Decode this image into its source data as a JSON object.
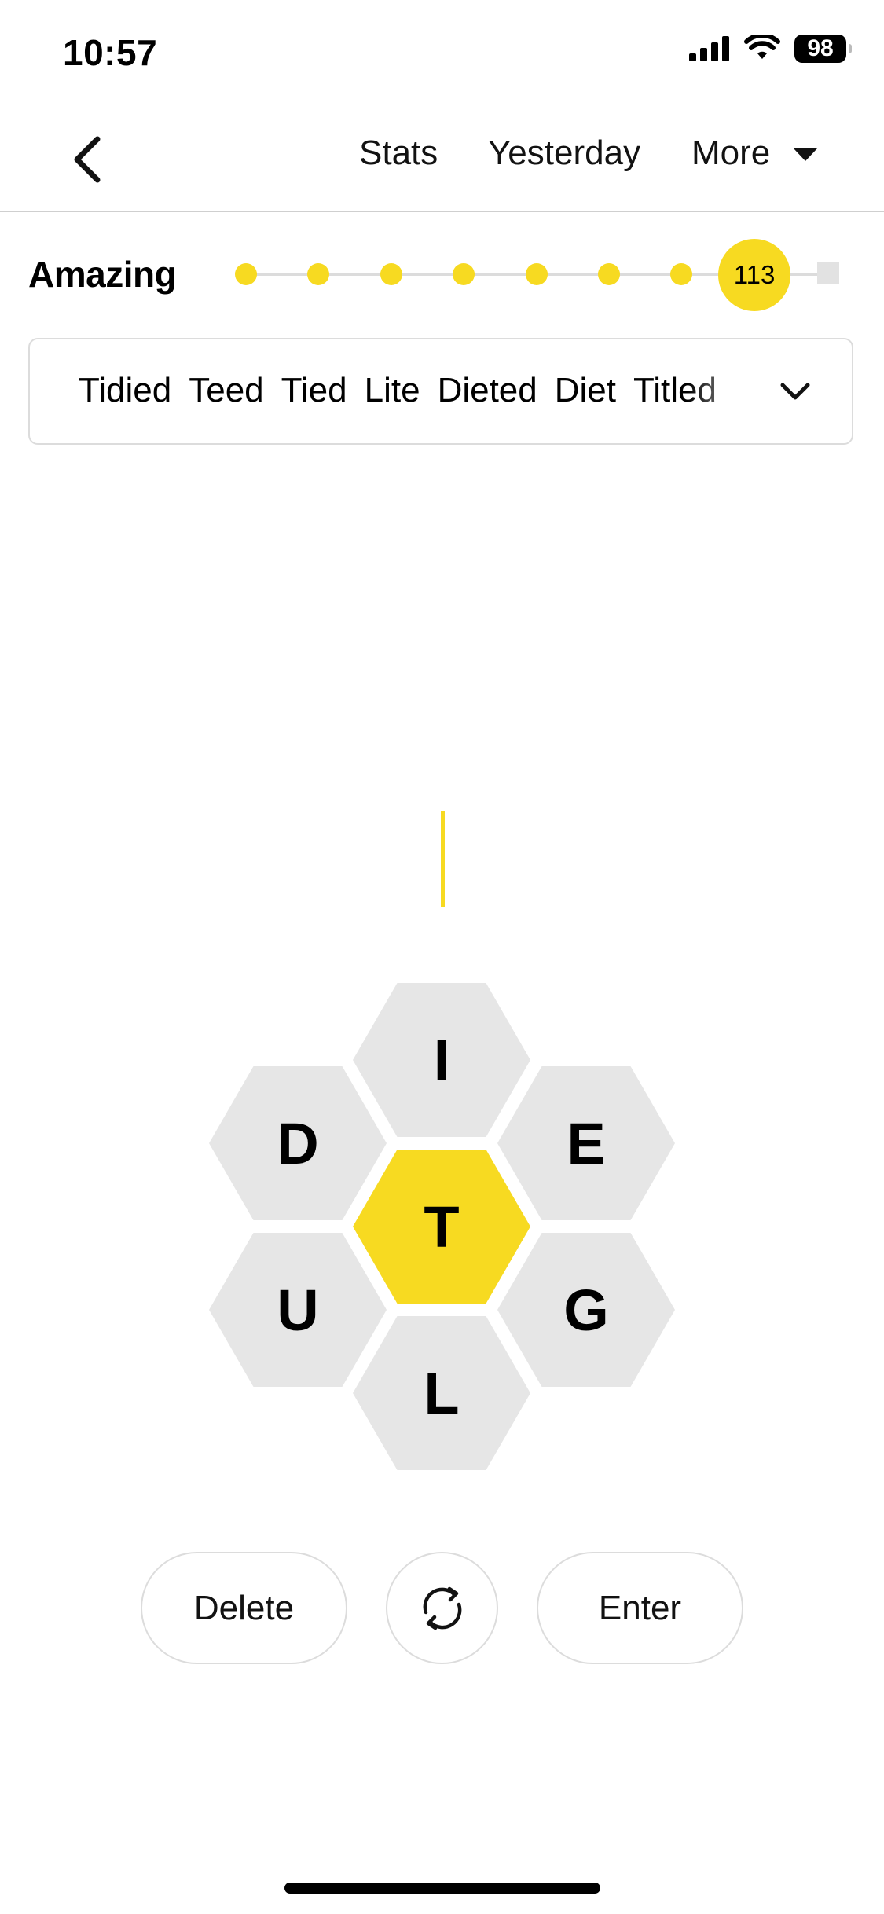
{
  "status_bar": {
    "time": "10:57",
    "battery": "98",
    "icons": [
      "signal-icon",
      "wifi-icon",
      "battery-icon"
    ]
  },
  "nav": {
    "back_icon": "chevron-left-icon",
    "stats": "Stats",
    "yesterday": "Yesterday",
    "more": "More",
    "more_icon": "caret-down-icon"
  },
  "rank": {
    "label": "Amazing",
    "score": "113",
    "levels_reached": 8,
    "levels_total": 9,
    "accent_color": "#f7da21"
  },
  "found_words": {
    "words": [
      "Tidied",
      "Teed",
      "Tied",
      "Lite",
      "Dieted",
      "Diet",
      "Titled"
    ],
    "toggle_icon": "chevron-down-icon"
  },
  "hive": {
    "center_letter": "T",
    "outer_letters": {
      "top": "I",
      "upper_left": "D",
      "upper_right": "E",
      "lower_left": "U",
      "lower_right": "G",
      "bottom": "L"
    },
    "center_color": "#f7da21",
    "outer_color": "#e6e6e6"
  },
  "controls": {
    "delete": "Delete",
    "shuffle_icon": "shuffle-icon",
    "enter": "Enter"
  }
}
